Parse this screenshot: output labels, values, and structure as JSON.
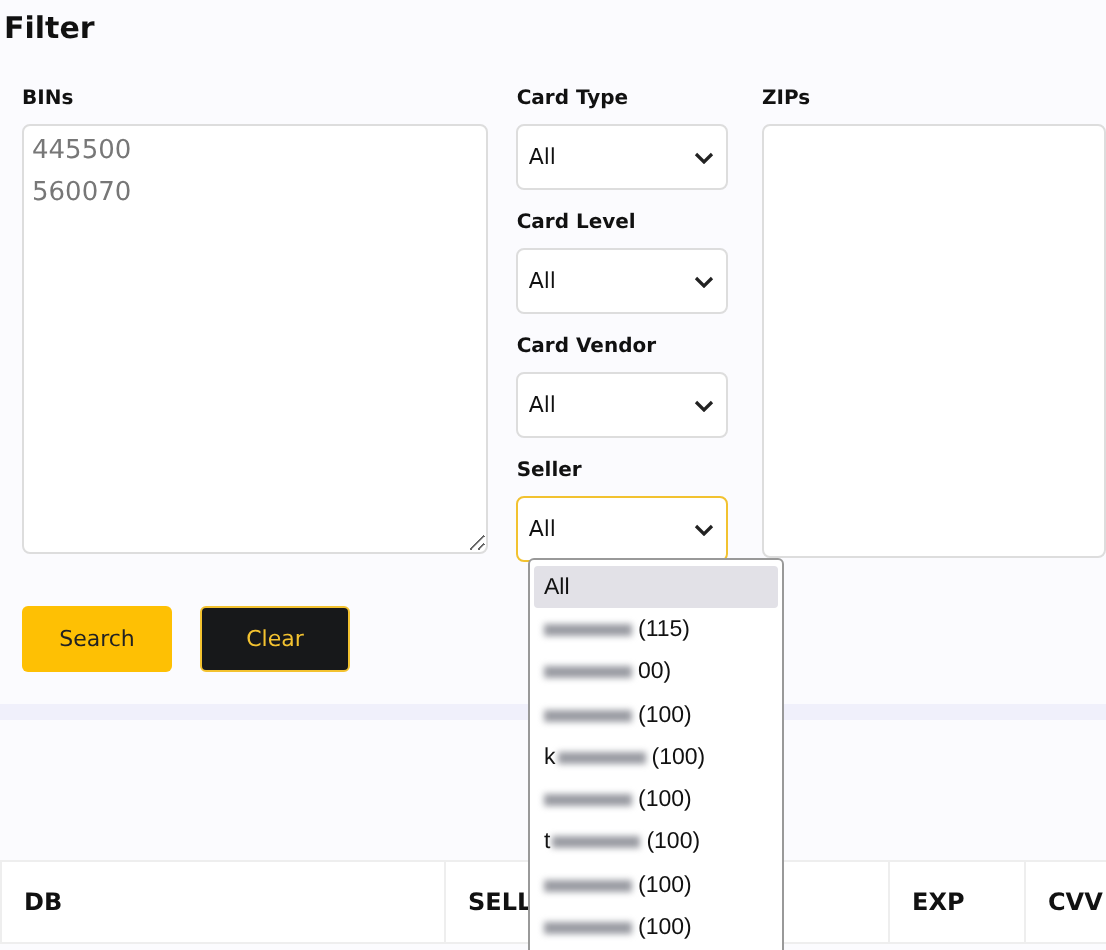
{
  "title": "Filter",
  "bins": {
    "label": "BINs",
    "placeholder": "445500\n560070"
  },
  "selects": [
    {
      "label": "Card Type",
      "value": "All",
      "focused": false
    },
    {
      "label": "Card Level",
      "value": "All",
      "focused": false
    },
    {
      "label": "Card Vendor",
      "value": "All",
      "focused": false
    },
    {
      "label": "Seller",
      "value": "All",
      "focused": true
    }
  ],
  "zips": {
    "label": "ZIPs"
  },
  "buttons": [
    {
      "label": "Search",
      "kind": "primary"
    },
    {
      "label": "Clear",
      "kind": "dark"
    }
  ],
  "seller_options": [
    {
      "prefix": "All",
      "redacted": false,
      "selected": true
    },
    {
      "count": "(115)",
      "redacted": true,
      "selected": false
    },
    {
      "count": "00)",
      "redacted": true,
      "selected": false
    },
    {
      "count": "(100)",
      "redacted": true,
      "selected": false
    },
    {
      "prefix": "k",
      "count": "(100)",
      "redacted": true,
      "selected": false
    },
    {
      "count": "(100)",
      "redacted": true,
      "selected": false
    },
    {
      "prefix": "t",
      "count": "(100)",
      "redacted": true,
      "selected": false
    },
    {
      "count": "(100)",
      "redacted": true,
      "selected": false
    },
    {
      "count": "(100)",
      "redacted": true,
      "selected": false
    }
  ],
  "table": {
    "columns": [
      "DB",
      "SELL",
      "",
      "EXP",
      "CVV"
    ]
  }
}
